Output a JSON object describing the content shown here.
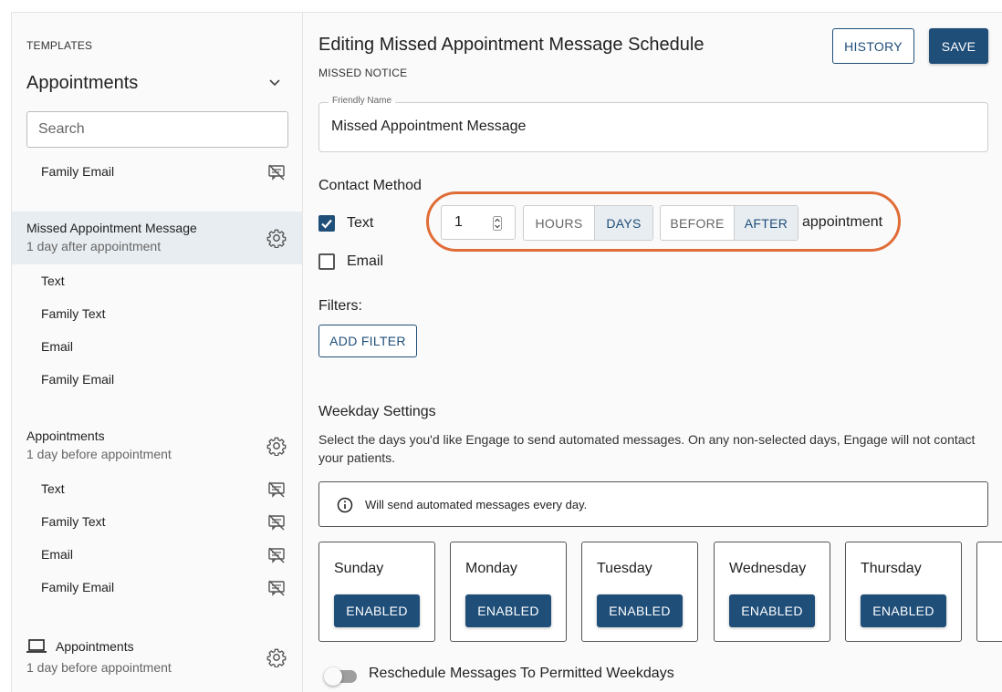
{
  "sidebar": {
    "label": "TEMPLATES",
    "selected": "Appointments",
    "search_placeholder": "Search",
    "top_item": "Family Email",
    "groups": [
      {
        "title": "Missed Appointment Message",
        "subtitle": "1 day after appointment",
        "icon": "gear-icon",
        "items": [
          "Text",
          "Family Text",
          "Email",
          "Family Email"
        ]
      },
      {
        "title": "Appointments",
        "subtitle": "1 day before appointment",
        "icon": "gear-icon",
        "items": [
          "Text",
          "Family Text",
          "Email",
          "Family Email"
        ]
      },
      {
        "title": "Appointments",
        "subtitle": "1 day before appointment",
        "icon": "gear-icon",
        "leading_icon": "laptop-icon"
      }
    ]
  },
  "main": {
    "title": "Editing Missed Appointment Message Schedule",
    "subtitle": "MISSED NOTICE",
    "history_label": "HISTORY",
    "save_label": "SAVE",
    "friendly_name_label": "Friendly Name",
    "friendly_name_value": "Missed Appointment Message",
    "contact_method_heading": "Contact Method",
    "contact_methods": [
      {
        "label": "Text",
        "checked": true
      },
      {
        "label": "Email",
        "checked": false
      }
    ],
    "offset_value": "1",
    "unit_options": [
      "HOURS",
      "DAYS"
    ],
    "unit_selected": "DAYS",
    "timing_options": [
      "BEFORE",
      "AFTER"
    ],
    "timing_selected": "AFTER",
    "appointment_word": "appointment",
    "filters_heading": "Filters:",
    "add_filter_label": "ADD FILTER",
    "weekday_heading": "Weekday Settings",
    "weekday_description": "Select the days you'd like Engage to send automated messages. On any non-selected days, Engage will not contact your patients.",
    "info_text": "Will send automated messages every day.",
    "days": [
      {
        "name": "Sunday",
        "status": "ENABLED"
      },
      {
        "name": "Monday",
        "status": "ENABLED"
      },
      {
        "name": "Tuesday",
        "status": "ENABLED"
      },
      {
        "name": "Wednesday",
        "status": "ENABLED"
      },
      {
        "name": "Thursday",
        "status": "ENABLED"
      }
    ],
    "reschedule_label": "Reschedule Messages To Permitted Weekdays",
    "reschedule_on": false
  },
  "colors": {
    "primary": "#1f4e79",
    "highlight": "#e06c37",
    "selected_bg": "#e8edf1"
  }
}
